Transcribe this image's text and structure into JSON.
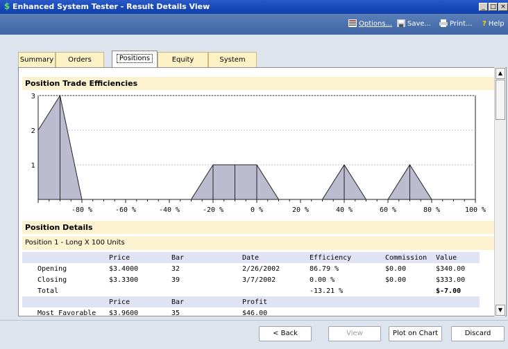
{
  "window": {
    "title": "Enhanced System Tester - Result Details View",
    "controls": [
      "_",
      "□",
      "×"
    ]
  },
  "toolbar": {
    "options": "Options...",
    "save": "Save...",
    "print": "Print...",
    "help": "Help"
  },
  "tabs": [
    {
      "label": "Summary",
      "active": false
    },
    {
      "label": "Orders",
      "active": false
    },
    {
      "label": "Positions",
      "active": true
    },
    {
      "label": "Equity",
      "active": false
    },
    {
      "label": "System",
      "active": false
    }
  ],
  "sections": {
    "efficiencies": "Position Trade Efficiencies",
    "details": "Position Details"
  },
  "chart_data": {
    "type": "area",
    "xlim": [
      -100,
      100
    ],
    "ylim": [
      0,
      3
    ],
    "yticks": [
      1,
      2,
      3
    ],
    "xticks": [
      -80,
      -60,
      -40,
      -20,
      0,
      20,
      40,
      60,
      80,
      100
    ],
    "xtick_labels": [
      "-80 %",
      "-60 %",
      "-40 %",
      "-20 %",
      "0 %",
      "20 %",
      "40 %",
      "60 %",
      "80 %",
      "100 %"
    ],
    "x": [
      -100,
      -90,
      -80,
      -70,
      -60,
      -50,
      -40,
      -30,
      -20,
      -10,
      0,
      10,
      20,
      30,
      40,
      50,
      60,
      70,
      80,
      90,
      100
    ],
    "y": [
      2,
      3,
      0,
      0,
      0,
      0,
      0,
      0,
      1,
      1,
      1,
      0,
      0,
      0,
      1,
      0,
      0,
      1,
      0,
      0,
      0
    ]
  },
  "position": {
    "header": "Position 1 - Long X 100 Units"
  },
  "details_table": {
    "headers": [
      "",
      "Price",
      "Bar",
      "Date",
      "Efficiency",
      "Commission",
      "Value"
    ],
    "rows": [
      [
        "Opening",
        "$3.4000",
        "32",
        "2/26/2002",
        "86.79 %",
        "$0.00",
        "$340.00"
      ],
      [
        "Closing",
        "$3.3300",
        "39",
        "3/7/2002",
        "0.00 %",
        "$0.00",
        "$333.00"
      ],
      [
        "Total",
        "",
        "",
        "",
        "-13.21 %",
        "",
        "$-7.00"
      ]
    ],
    "headers2": [
      "",
      "Price",
      "Bar",
      "Profit",
      "",
      "",
      ""
    ],
    "partial_row": [
      "Most Favorable",
      "$3.9600",
      "35",
      "$46.00"
    ]
  },
  "buttons": {
    "back": "< Back",
    "view": "View",
    "plot": "Plot on Chart",
    "discard": "Discard"
  },
  "colors": {
    "title_bar": "#1848b8",
    "toolbar": "#4a70ad",
    "tab": "#fdf1c6",
    "section": "#fdf3d0",
    "header_row": "#dfe3f4",
    "area_fill": "#bdbbcf"
  }
}
